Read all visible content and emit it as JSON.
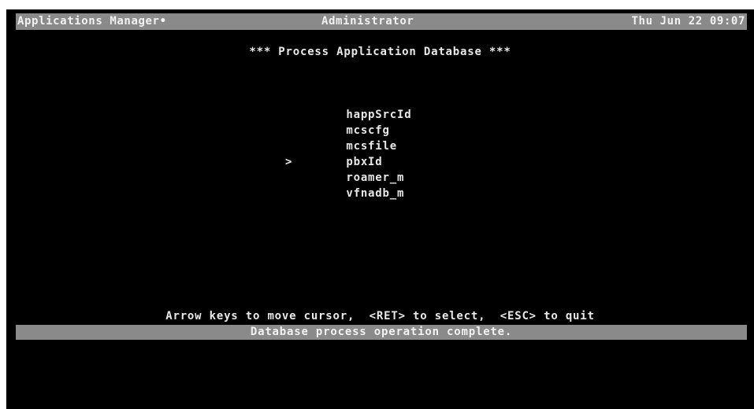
{
  "title_bar": {
    "left": "Applications Manager•",
    "center": "Administrator",
    "right": "Thu Jun 22 09:07"
  },
  "heading": "*** Process Application Database ***",
  "menu": {
    "cursor": ">",
    "selected_index": 5,
    "items": [
      {
        "label": "happSrcId"
      },
      {
        "label": "mcscfg"
      },
      {
        "label": "mcsfile"
      },
      {
        "label": "pbxId"
      },
      {
        "label": "roamer_m"
      },
      {
        "label": "vfnadb_m"
      }
    ]
  },
  "help_line": "Arrow keys to move cursor,  <RET> to select,  <ESC> to quit",
  "status_bar": "Database process operation complete.",
  "colors": {
    "background": "#000000",
    "text": "#e8e8e8",
    "bar": "#8a8a8a"
  }
}
